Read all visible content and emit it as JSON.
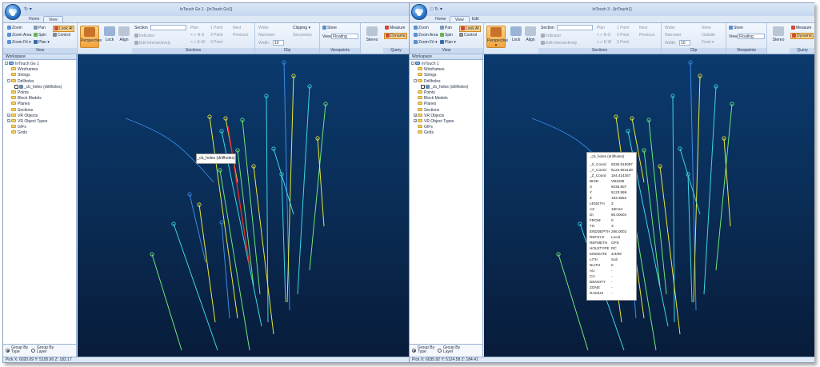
{
  "left": {
    "title": "InTouch Go 1 - [InTouch Go1]",
    "qat": "↻ ▾",
    "tabs": [
      "Home",
      "View"
    ],
    "status": "Pick X: 6020.09 Y: 5105.90 Z: 182.17",
    "tooltip": "_cb_holes (drillholes)"
  },
  "right": {
    "title": "InTouch 3 - [InTouch1]",
    "qat": "□ ↻ ▾",
    "tabs": [
      "Home",
      "View",
      "Edit"
    ],
    "status": "Pick X: 6035.92 Y: 5124.58 Z: 184.41",
    "popup": {
      "header": "_cb_holes (drillholes)",
      "rows": [
        {
          "k": "_X_Coord",
          "v": "6035.916087"
        },
        {
          "k": "_Y_Coord",
          "v": "5124.563138"
        },
        {
          "k": "_Z_Coord",
          "v": "184.414267"
        },
        {
          "k": "BHID",
          "v": "VB4285"
        },
        {
          "k": "X",
          "v": "6035.907"
        },
        {
          "k": "Y",
          "v": "5123.599"
        },
        {
          "k": "Z",
          "v": "183.3652"
        },
        {
          "k": "LENGTH",
          "v": "3"
        },
        {
          "k": "AZ",
          "v": "180.54"
        },
        {
          "k": "DI",
          "v": "80.00004"
        },
        {
          "k": "FROM",
          "v": "0"
        },
        {
          "k": "TO",
          "v": "3"
        },
        {
          "k": "ENDDEPTH",
          "v": "286.0002"
        },
        {
          "k": "REFSYS",
          "v": "Local"
        },
        {
          "k": "REFMETH",
          "v": "GPS"
        },
        {
          "k": "HOLETYPE",
          "v": "RC"
        },
        {
          "k": "ENDDATE",
          "v": "4/4/99"
        },
        {
          "k": "LITH",
          "v": "Soil"
        },
        {
          "k": "NLITH",
          "v": "0"
        },
        {
          "k": "AU",
          "v": "-"
        },
        {
          "k": "CU",
          "v": "-"
        },
        {
          "k": "DENSITY",
          "v": "-"
        },
        {
          "k": "ZONE",
          "v": "-"
        },
        {
          "k": "RADIUS",
          "v": "-"
        }
      ]
    }
  },
  "ribbon": {
    "view_group": {
      "zoom": "Zoom",
      "pan": "Pan",
      "look_at": "Look At",
      "zoom_area": "Zoom Area",
      "spin": "Spin",
      "control": "Control",
      "zoom_fit": "Zoom Fit ▾",
      "plan": "Plan ▾",
      "label": "View"
    },
    "perspective": "Perspective",
    "perspective_right": "Perspective ▾",
    "lock": "Lock",
    "align": "Align",
    "sections": {
      "section_label": "Section",
      "indicator": "Indicator",
      "edit_intersectively": "Edit Intersectively",
      "plan": "Plan",
      "one_point": "1 Point",
      "ns": "< > N-S",
      "two_point": "2 Point",
      "ew": "< > E-W",
      "three_point": "3 Point",
      "next": "Next",
      "previous": "Previous",
      "label": "Sections"
    },
    "clip": {
      "wider": "Wider",
      "narrower": "Narrower",
      "width": "Width:",
      "width_value": "10",
      "label": "Clip"
    },
    "clipping": {
      "clipping": "Clipping ▾",
      "secondary": "Secondary",
      "none": "None",
      "outside": "Outside",
      "front": "Front ▾"
    },
    "viewpoints": {
      "store": "Store",
      "view_label": "View",
      "view_value": "Floating",
      "label": "Viewpoints"
    },
    "stereo": "Stereo",
    "query": {
      "measure": "Measure",
      "dynamic": "Dynamic",
      "label": "Query"
    }
  },
  "workspace": {
    "title": "Workspace",
    "items": [
      "InTouch Go 1",
      "Wireframes",
      "Strings",
      "Drillholes",
      "_cb_holes (drillholes)",
      "Points",
      "Block Models",
      "Planes",
      "Sections",
      "VR Objects",
      "VR Object Types",
      "GIFs",
      "Grids"
    ],
    "items_right": [
      "InTouch 1",
      "Wireframes",
      "Strings",
      "Drillholes",
      "_cb_holes (drillholes)",
      "Points",
      "Block Models",
      "Planes",
      "Sections",
      "VR Objects",
      "VR Object Types",
      "GIFs",
      "Grids"
    ],
    "group_by_type": "Group By Type",
    "group_by_layer": "Group By Layer"
  },
  "colors": {
    "accent_orange": "#f4a23c",
    "viewport_top": "#0b3a6e",
    "viewport_bottom": "#081c3a",
    "hole_yellow": "#e8e83c",
    "hole_cyan": "#3cd6e6",
    "hole_green": "#6ee67a",
    "hole_blue": "#3c8ce6",
    "hole_red": "#e62828"
  }
}
